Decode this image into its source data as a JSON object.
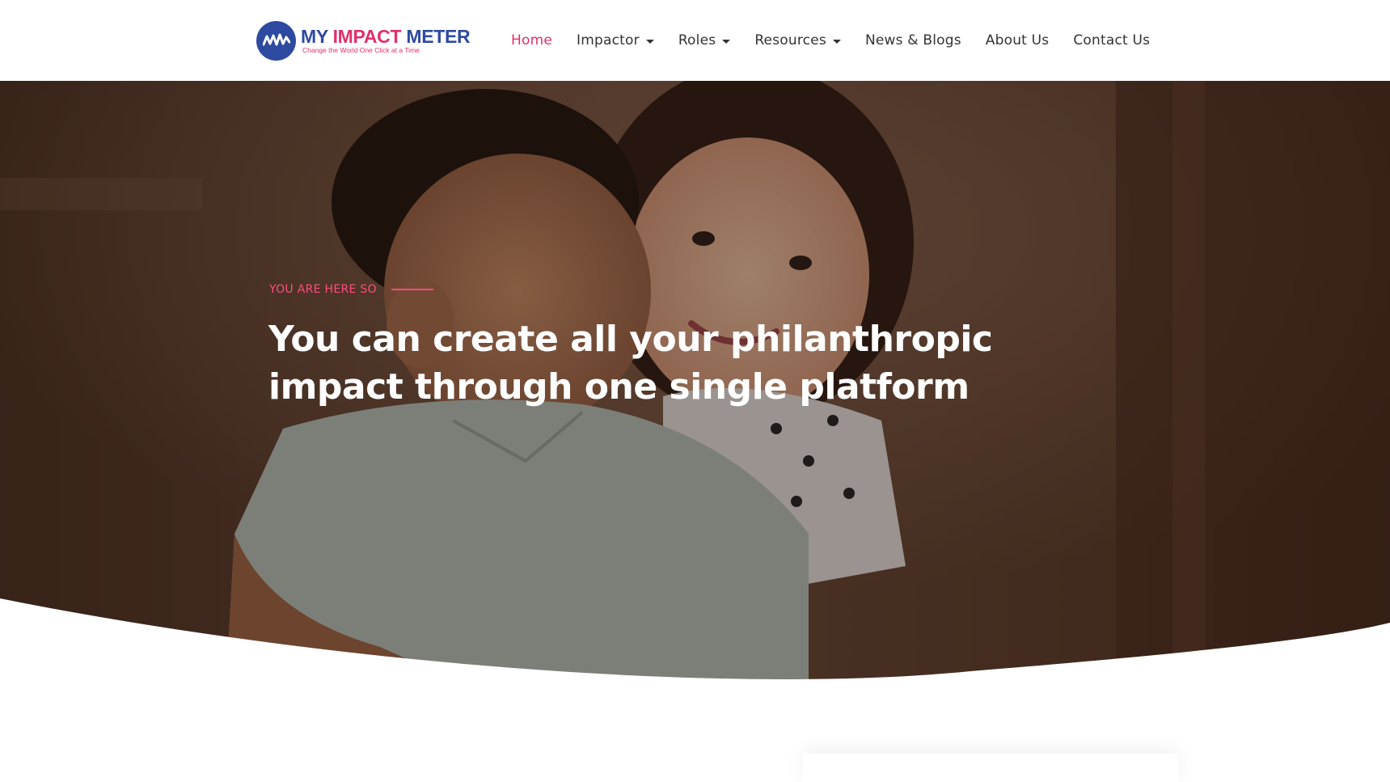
{
  "brand": {
    "name_part1": "MY",
    "name_part2": "IMPACT",
    "name_part3": "METER",
    "tagline": "Change the World One Click at a Time",
    "colors": {
      "primary": "#2e4aa0",
      "accent": "#e0306a"
    }
  },
  "nav": {
    "items": [
      {
        "label": "Home",
        "active": true,
        "dropdown": false
      },
      {
        "label": "Impactor",
        "active": false,
        "dropdown": true
      },
      {
        "label": "Roles",
        "active": false,
        "dropdown": true
      },
      {
        "label": "Resources",
        "active": false,
        "dropdown": true
      },
      {
        "label": "News & Blogs",
        "active": false,
        "dropdown": false
      },
      {
        "label": "About Us",
        "active": false,
        "dropdown": false
      },
      {
        "label": "Contact Us",
        "active": false,
        "dropdown": false
      }
    ]
  },
  "hero": {
    "eyebrow": "YOU ARE HERE SO",
    "headline_line1": "You can create all your philanthropic",
    "headline_line2": "impact through one single platform",
    "image": "hero-photo-two-children-hugging",
    "eyebrow_color": "#ff4d7e"
  }
}
